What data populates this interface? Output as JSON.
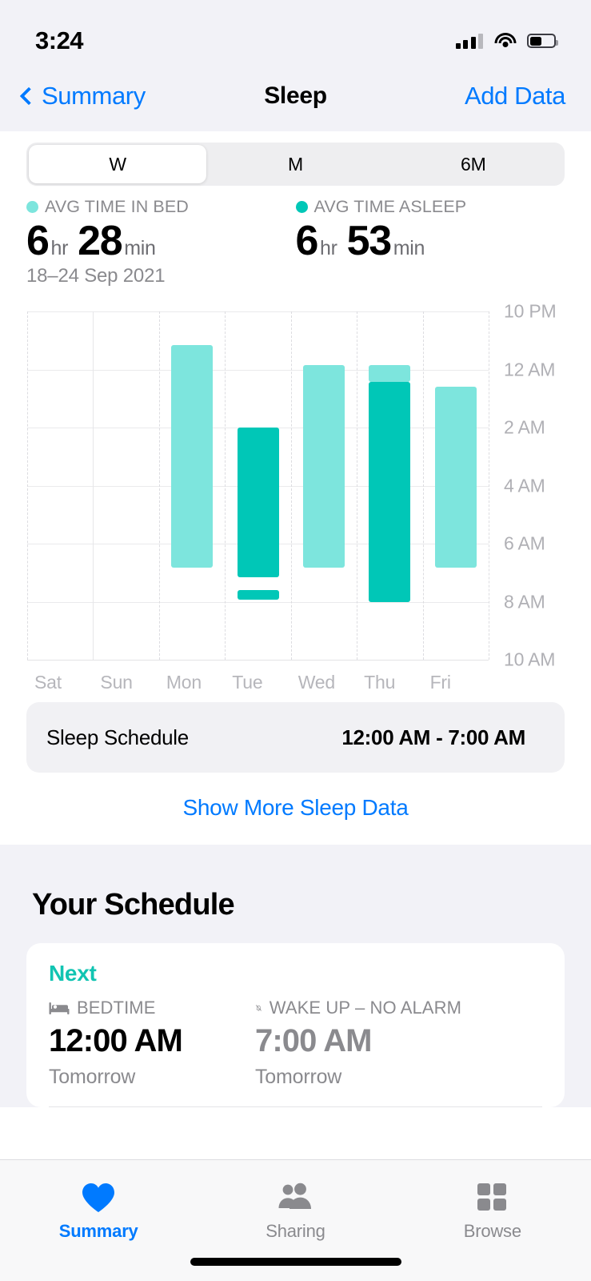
{
  "status_bar": {
    "time": "3:24",
    "cellular_icon": "cellular-signal-icon",
    "wifi_icon": "wifi-icon",
    "battery_icon": "battery-icon",
    "battery_level_pct": 45
  },
  "nav": {
    "back_label": "Summary",
    "back_icon": "chevron-left-icon",
    "title": "Sleep",
    "action_label": "Add Data"
  },
  "segmented": {
    "options": [
      "W",
      "M",
      "6M"
    ],
    "selected": "W"
  },
  "stats": [
    {
      "legend_label": "AVG TIME IN BED",
      "dot_color": "#7de5dd",
      "hours": "6",
      "hours_unit": "hr",
      "minutes": "28",
      "minutes_unit": "min"
    },
    {
      "legend_label": "AVG TIME ASLEEP",
      "dot_color": "#00c7b7",
      "hours": "6",
      "hours_unit": "hr",
      "minutes": "53",
      "minutes_unit": "min"
    }
  ],
  "date_range": "18–24 Sep 2021",
  "chart_data": {
    "type": "bar",
    "title": "Sleep — Time in Bed vs Time Asleep",
    "subtitle": "18–24 Sep 2021",
    "xlabel": "",
    "ylabel": "",
    "categories": [
      "Sat",
      "Sun",
      "Mon",
      "Tue",
      "Wed",
      "Thu",
      "Fri"
    ],
    "y_tick_labels": [
      "10 PM",
      "12 AM",
      "2 AM",
      "4 AM",
      "6 AM",
      "8 AM",
      "10 AM"
    ],
    "y_tick_hours": [
      22,
      24,
      26,
      28,
      30,
      32,
      34
    ],
    "ylim_labels": [
      "10 PM",
      "10 AM"
    ],
    "grid": true,
    "legend_position": "above-chart",
    "legend": [
      {
        "name": "Time in Bed",
        "color": "#7de5dd"
      },
      {
        "name": "Time Asleep",
        "color": "#00c7b7"
      }
    ],
    "series": [
      {
        "name": "Time in Bed",
        "color": "#7de5dd",
        "unit": "clock-hour",
        "values": [
          null,
          null,
          23.15,
          null,
          23.6,
          23.55,
          23.45
        ]
      },
      {
        "name": "Time Asleep",
        "color": "#00c7b7",
        "unit": "clock-hour",
        "values": [
          null,
          null,
          null,
          25.05,
          null,
          23.85,
          null
        ]
      }
    ],
    "bars": [
      {
        "day": "Sat",
        "segments": []
      },
      {
        "day": "Sun",
        "segments": []
      },
      {
        "day": "Mon",
        "segments": [
          {
            "series": "Time in Bed",
            "start": "11:10 PM",
            "end": "6:50 AM",
            "color": "#7de5dd"
          }
        ]
      },
      {
        "day": "Tue",
        "segments": [
          {
            "series": "Time Asleep",
            "start": "2:00 AM",
            "end": "7:10 AM",
            "color": "#00c7b7"
          },
          {
            "series": "Time Asleep",
            "start": "7:35 AM",
            "end": "7:55 AM",
            "color": "#00c7b7"
          }
        ]
      },
      {
        "day": "Wed",
        "segments": [
          {
            "series": "Time in Bed",
            "start": "11:50 PM",
            "end": "6:50 AM",
            "color": "#7de5dd"
          }
        ]
      },
      {
        "day": "Thu",
        "segments": [
          {
            "series": "Time in Bed",
            "start": "11:50 PM",
            "end": "12:25 AM",
            "color": "#7de5dd"
          },
          {
            "series": "Time Asleep",
            "start": "12:25 AM",
            "end": "8:00 AM",
            "color": "#00c7b7"
          }
        ]
      },
      {
        "day": "Fri",
        "segments": [
          {
            "series": "Time in Bed",
            "start": "12:35 AM",
            "end": "6:50 AM",
            "color": "#7de5dd"
          }
        ]
      }
    ]
  },
  "sleep_schedule_row": {
    "label": "Sleep Schedule",
    "value": "12:00 AM - 7:00 AM"
  },
  "show_more_label": "Show More Sleep Data",
  "your_schedule": {
    "title": "Your Schedule",
    "next_label": "Next",
    "bedtime": {
      "icon": "bed-icon",
      "heading": "BEDTIME",
      "time": "12:00 AM",
      "sub": "Tomorrow"
    },
    "wakeup": {
      "icon": "bell-slash-icon",
      "heading": "WAKE UP – NO ALARM",
      "time": "7:00 AM",
      "sub": "Tomorrow"
    }
  },
  "tabbar": {
    "items": [
      {
        "label": "Summary",
        "icon": "heart-icon",
        "active": true
      },
      {
        "label": "Sharing",
        "icon": "people-icon",
        "active": false
      },
      {
        "label": "Browse",
        "icon": "grid-icon",
        "active": false
      }
    ],
    "active_color": "#007aff"
  },
  "colors": {
    "accent_blue": "#007aff",
    "teal_light": "#7de5dd",
    "teal_dark": "#00c7b7",
    "bg_grouped": "#f2f2f7"
  }
}
